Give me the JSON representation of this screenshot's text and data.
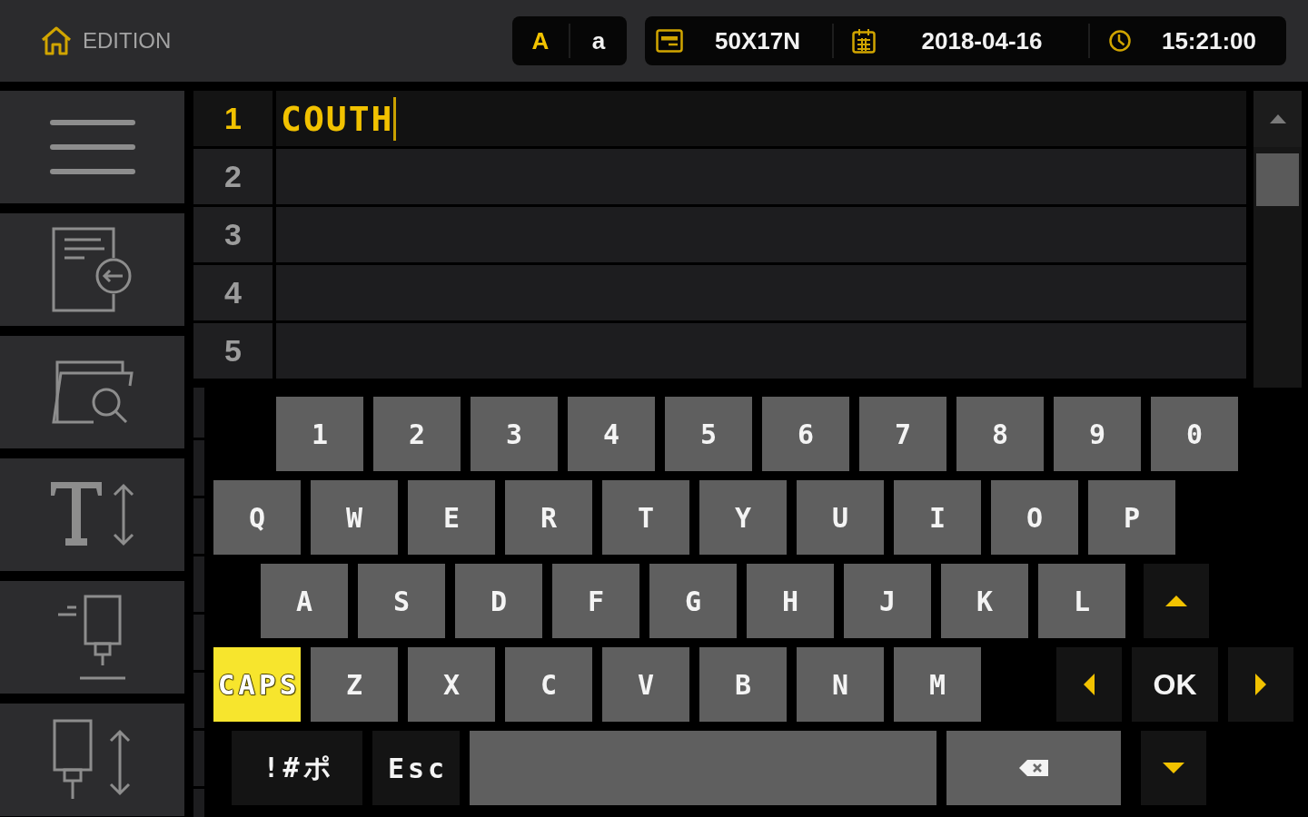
{
  "header": {
    "title": "EDITION",
    "case_options": [
      {
        "label": "A",
        "selected": true
      },
      {
        "label": "a",
        "selected": false
      }
    ],
    "status": [
      {
        "kind": "label",
        "text": "50X17N"
      },
      {
        "kind": "date",
        "text": "2018-04-16"
      },
      {
        "kind": "time",
        "text": "15:21:00"
      }
    ]
  },
  "editor": {
    "lines": [
      {
        "number": "1",
        "text": "COUTH",
        "selected": true
      },
      {
        "number": "2",
        "selected": false
      },
      {
        "number": "3",
        "selected": false
      },
      {
        "number": "4",
        "selected": false
      },
      {
        "number": "5",
        "selected": false
      }
    ]
  },
  "keyboard": {
    "rows": [
      [
        {
          "kind": "char",
          "label": "1"
        },
        {
          "kind": "char",
          "label": "2"
        },
        {
          "kind": "char",
          "label": "3"
        },
        {
          "kind": "char",
          "label": "4"
        },
        {
          "kind": "char",
          "label": "5"
        },
        {
          "kind": "char",
          "label": "6"
        },
        {
          "kind": "char",
          "label": "7"
        },
        {
          "kind": "char",
          "label": "8"
        },
        {
          "kind": "char",
          "label": "9"
        },
        {
          "kind": "char",
          "label": "0"
        }
      ],
      [
        {
          "kind": "char",
          "label": "Q"
        },
        {
          "kind": "char",
          "label": "W"
        },
        {
          "kind": "char",
          "label": "E"
        },
        {
          "kind": "char",
          "label": "R"
        },
        {
          "kind": "char",
          "label": "T"
        },
        {
          "kind": "char",
          "label": "Y"
        },
        {
          "kind": "char",
          "label": "U"
        },
        {
          "kind": "char",
          "label": "I"
        },
        {
          "kind": "char",
          "label": "O"
        },
        {
          "kind": "char",
          "label": "P"
        }
      ],
      [
        {
          "kind": "char",
          "label": "A"
        },
        {
          "kind": "char",
          "label": "S"
        },
        {
          "kind": "char",
          "label": "D"
        },
        {
          "kind": "char",
          "label": "F"
        },
        {
          "kind": "char",
          "label": "G"
        },
        {
          "kind": "char",
          "label": "H"
        },
        {
          "kind": "char",
          "label": "J"
        },
        {
          "kind": "char",
          "label": "K"
        },
        {
          "kind": "char",
          "label": "L"
        },
        {
          "kind": "up"
        }
      ],
      [
        {
          "kind": "caps",
          "label": "CAPS",
          "on": true
        },
        {
          "kind": "char",
          "label": "Z"
        },
        {
          "kind": "char",
          "label": "X"
        },
        {
          "kind": "char",
          "label": "C"
        },
        {
          "kind": "char",
          "label": "V"
        },
        {
          "kind": "char",
          "label": "B"
        },
        {
          "kind": "char",
          "label": "N"
        },
        {
          "kind": "char",
          "label": "M"
        },
        {
          "kind": "left"
        },
        {
          "kind": "ok",
          "label": "OK"
        },
        {
          "kind": "right"
        }
      ],
      [
        {
          "kind": "symbols",
          "label": "!#ポ"
        },
        {
          "kind": "escape",
          "label": "Esc"
        },
        {
          "kind": "space"
        },
        {
          "kind": "backspace"
        },
        {
          "kind": "down"
        }
      ]
    ]
  }
}
